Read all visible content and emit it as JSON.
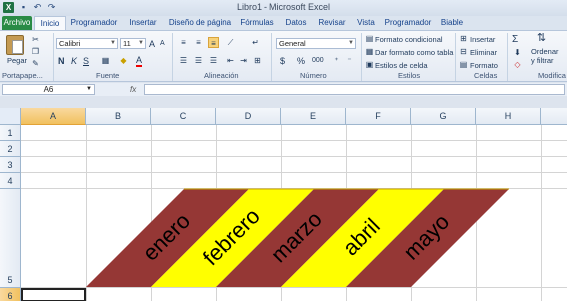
{
  "window": {
    "title_doc": "Libro1",
    "title_sep": "-",
    "title_app": "Microsoft Excel"
  },
  "quick_access": [
    "save-icon",
    "undo-icon",
    "redo-icon"
  ],
  "tabs": [
    "Archivo",
    "Inicio",
    "Programador",
    "Insertar",
    "Diseño de página",
    "Fórmulas",
    "Datos",
    "Revisar",
    "Vista",
    "Programador",
    "Biable"
  ],
  "active_tab": "Inicio",
  "ribbon": {
    "clipboard": {
      "paste": "Pegar",
      "label": "Portapape..."
    },
    "font": {
      "name": "Calibri",
      "size": "11",
      "grow": "A",
      "shrink": "A",
      "bold": "N",
      "italic": "K",
      "underline": "S",
      "font_color_letter": "A",
      "label": "Fuente"
    },
    "alignment": {
      "label": "Alineación"
    },
    "number": {
      "format": "General",
      "currency": "$",
      "percent": "%",
      "thousands": "000",
      "label": "Número"
    },
    "styles": {
      "conditional": "Formato condicional",
      "as_table": "Dar formato como tabla",
      "cell_styles": "Estilos de celda",
      "label": "Estilos"
    },
    "cells": {
      "insert": "Insertar",
      "delete": "Eliminar",
      "format": "Formato",
      "label": "Celdas"
    },
    "editing": {
      "sum": "Σ",
      "sort_line1": "Ordenar",
      "sort_line2": "y filtrar",
      "label": "Modifica"
    }
  },
  "formula_bar": {
    "name_box": "A6",
    "fx": "fx",
    "formula": ""
  },
  "columns": [
    "A",
    "B",
    "C",
    "D",
    "E",
    "F",
    "G",
    "H"
  ],
  "rows": [
    "1",
    "2",
    "3",
    "4",
    "5",
    "6"
  ],
  "selected_cell": "A6",
  "bands": [
    {
      "text": "enero",
      "color": "#953735"
    },
    {
      "text": "febrero",
      "color": "#ffff00"
    },
    {
      "text": "marzo",
      "color": "#953735"
    },
    {
      "text": "abril",
      "color": "#ffff00"
    },
    {
      "text": "mayo",
      "color": "#953735"
    }
  ],
  "colors": {
    "file_tab": "#2a8b45",
    "selection_header": "#f1c15f",
    "band_dark": "#953735",
    "band_light": "#ffff00"
  }
}
